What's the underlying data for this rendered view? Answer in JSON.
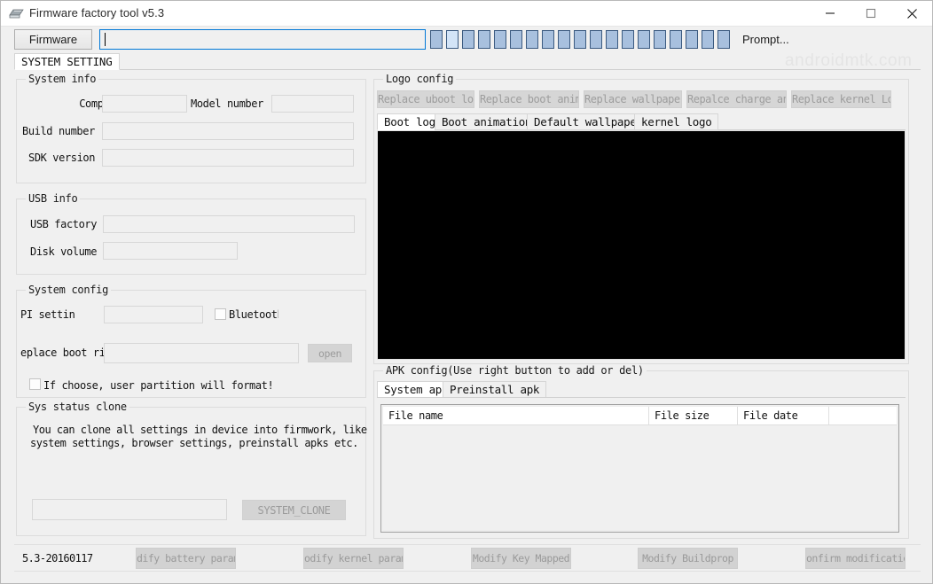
{
  "window": {
    "title": "Firmware factory tool v5.3",
    "icon": "app-icon",
    "minimize_label": "–",
    "maximize_label": "□",
    "close_label": "✕"
  },
  "toolbar": {
    "firmware_button": "Firmware",
    "path_value": "",
    "path_placeholder": "",
    "prompt_label": "Prompt...",
    "progress_blocks": 19,
    "progress_filled_index": 1,
    "progress_block_color": "#a8c0de",
    "progress_lead_color": "#d3e4f7"
  },
  "watermark": {
    "text": "androidmtk.com"
  },
  "main_tabs": [
    {
      "label": "SYSTEM SETTING",
      "active": true
    }
  ],
  "system_info": {
    "title": "System info",
    "fields": [
      {
        "label": "Company",
        "value": ""
      },
      {
        "label": "Model number",
        "value": ""
      },
      {
        "label": "Build number",
        "value": ""
      },
      {
        "label": "SDK version",
        "value": ""
      }
    ]
  },
  "usb_info": {
    "title": "USB info",
    "fields": [
      {
        "label": "USB factory",
        "value": ""
      },
      {
        "label": "Disk volume",
        "value": ""
      }
    ]
  },
  "system_config": {
    "title": "System config",
    "dpi_label": "PI settin",
    "dpi_value": "",
    "bluetooth_label": "Bluetooth",
    "bluetooth_checked": false,
    "bootring_label": "eplace boot rin",
    "bootring_value": "",
    "open_button": "open",
    "format_checkbox_label": "If choose, user partition will format!",
    "format_checked": false
  },
  "sys_status_clone": {
    "title": "Sys status clone",
    "description_line1": "You can clone all settings in device into firmwork, like",
    "description_line2": "system settings, browser settings, preinstall apks etc.",
    "field_value": "",
    "clone_button": "SYSTEM_CLONE"
  },
  "logo_config": {
    "title": "Logo config",
    "buttons": [
      "Replace uboot logo",
      "Replace boot anim",
      "Replace wallpaper",
      "Repalce charge anim",
      "Replace kernel Logo"
    ],
    "tabs": [
      {
        "label": "Boot logo",
        "active": true
      },
      {
        "label": "Boot animation",
        "active": false
      },
      {
        "label": "Default wallpaper",
        "active": false
      },
      {
        "label": "kernel logo",
        "active": false
      }
    ],
    "preview_color": "#000000"
  },
  "apk_config": {
    "title": "APK config(Use right button to add or del)",
    "tabs": [
      {
        "label": "System apk",
        "active": true
      },
      {
        "label": "Preinstall apk",
        "active": false
      }
    ],
    "columns": [
      "File name",
      "File size",
      "File date",
      ""
    ],
    "rows": []
  },
  "status_bar": {
    "version": "5.3-20160117",
    "buttons": [
      "dify battery param",
      "odify kernel param",
      "Modify Key Mapped",
      "Modify Buildprop",
      "onfirm modification"
    ]
  }
}
